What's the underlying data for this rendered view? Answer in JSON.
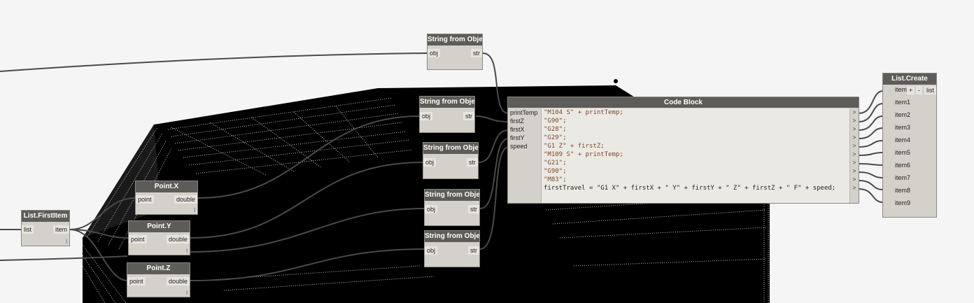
{
  "nodes": {
    "list_first_item": {
      "title": "List.FirstItem",
      "in": "list",
      "out": "item",
      "lacing": "l"
    },
    "point_x": {
      "title": "Point.X",
      "in": "point",
      "out": "double",
      "lacing": "l"
    },
    "point_y": {
      "title": "Point.Y",
      "in": "point",
      "out": "double",
      "lacing": "l"
    },
    "point_z": {
      "title": "Point.Z",
      "in": "point",
      "out": "double",
      "lacing": "l"
    },
    "string_from_object": {
      "title": "String from Object",
      "in": "obj",
      "out": "str"
    },
    "code_block": {
      "title": "Code Block",
      "inputs": [
        "printTemp",
        "firstZ",
        "firstX",
        "firstY",
        "speed"
      ],
      "output_arrow": ">"
    },
    "list_create": {
      "title": "List.Create",
      "plus": "+",
      "minus": "-",
      "out": "list",
      "items": [
        "item0",
        "item1",
        "item2",
        "item3",
        "item4",
        "item5",
        "item6",
        "item7",
        "item8",
        "item9"
      ]
    }
  },
  "code_lines": [
    "\"M104 S\" + printTemp;",
    "\"G90\";",
    "\"G28\";",
    "\"G29\";",
    "\"G1 Z\" + firstZ;",
    "\"M109 S\" + printTemp;",
    "\"G21\";",
    "\"G90\";",
    "\"M83\";",
    "firstTravel = \"G1 X\" + firstX + \" Y\" + firstY + \" Z\" + firstZ + \" F\" + speed;"
  ],
  "colors": {
    "canvas": "#f5f5f5",
    "geometry": "#000000",
    "wire": "#4a4a4a",
    "node_header": "#5e5c58",
    "node_body": "#d4d1ca"
  }
}
